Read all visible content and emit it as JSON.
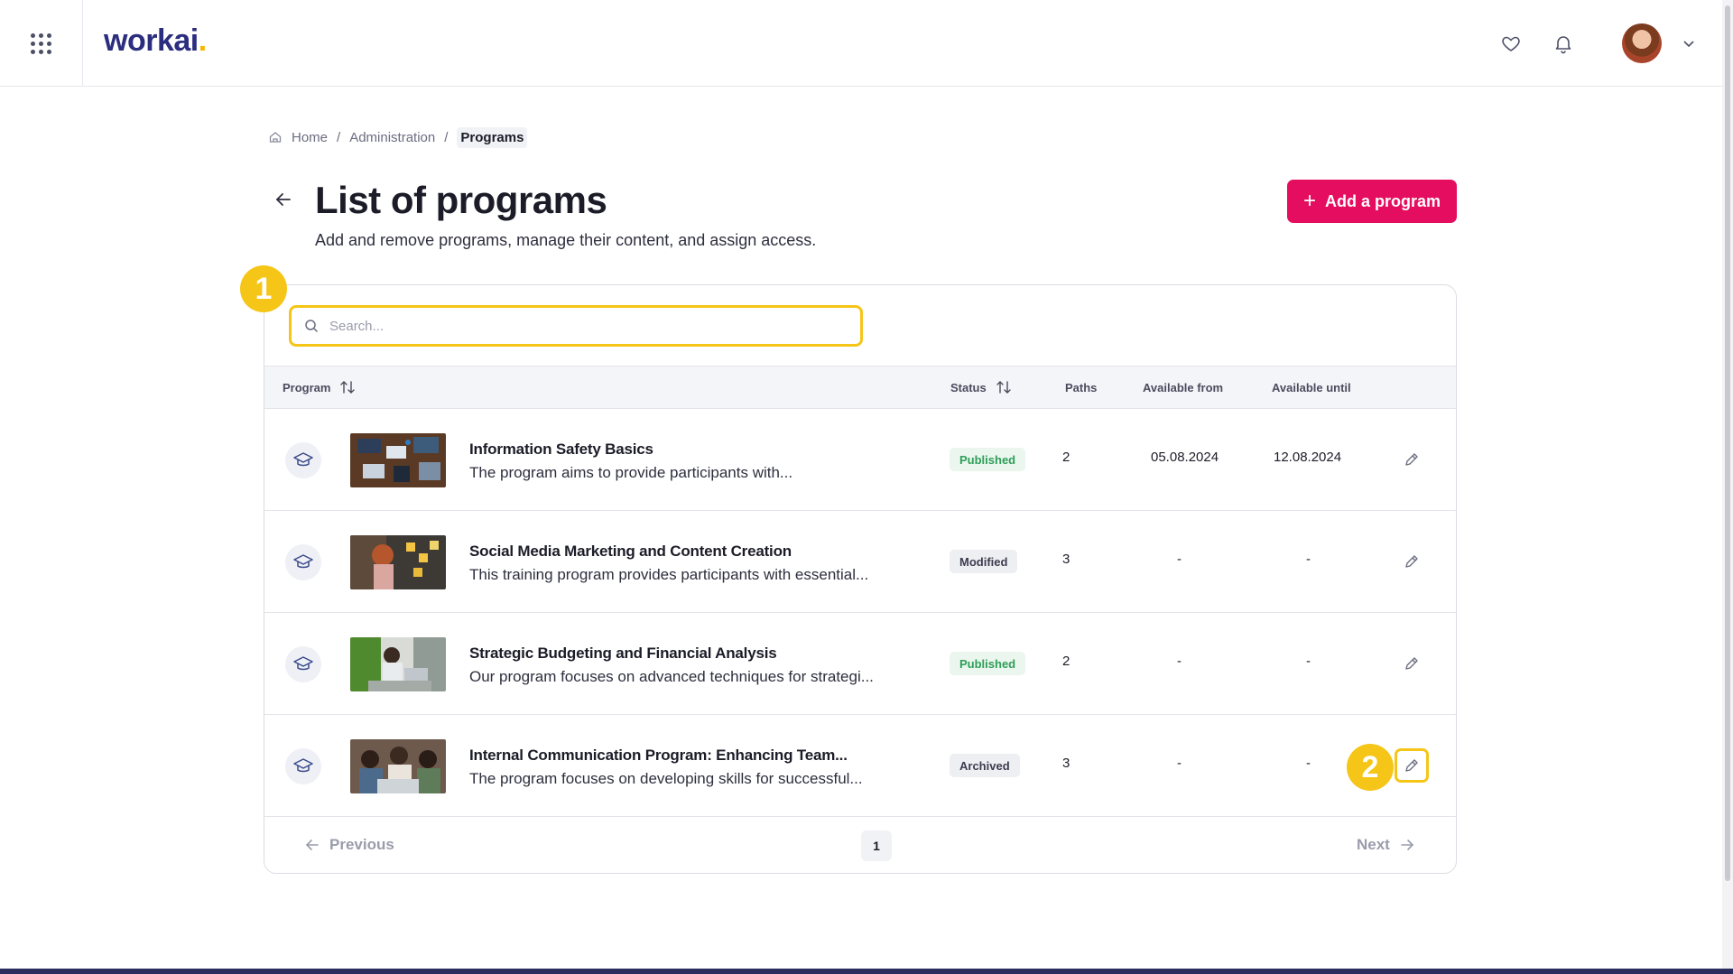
{
  "app": {
    "logo_text": "workai",
    "logo_dot": "."
  },
  "header": {
    "icons": [
      "apps-grid-icon",
      "heart-icon",
      "bell-icon",
      "user-avatar",
      "chevron-down-icon"
    ]
  },
  "breadcrumb": {
    "home": "Home",
    "sep1": "/",
    "admin": "Administration",
    "sep2": "/",
    "current": "Programs"
  },
  "page": {
    "title": "List of programs",
    "subtitle": "Add and remove programs, manage their content, and assign access.",
    "add_button": "Add a program"
  },
  "search": {
    "placeholder": "Search..."
  },
  "table": {
    "headers": {
      "program": "Program",
      "status": "Status",
      "paths": "Paths",
      "available_from": "Available from",
      "available_until": "Available until"
    },
    "rows": [
      {
        "title": "Information Safety Basics",
        "description": "The program aims to provide participants with...",
        "status": "Published",
        "paths": "2",
        "available_from": "05.08.2024",
        "available_until": "12.08.2024"
      },
      {
        "title": "Social Media Marketing and Content Creation",
        "description": "This training program provides participants with essential...",
        "status": "Modified",
        "paths": "3",
        "available_from": "-",
        "available_until": "-"
      },
      {
        "title": "Strategic Budgeting and Financial Analysis",
        "description": "Our program focuses on advanced techniques for strategi...",
        "status": "Published",
        "paths": "2",
        "available_from": "-",
        "available_until": "-"
      },
      {
        "title": "Internal Communication Program: Enhancing Team...",
        "description": "The program focuses on developing skills for successful...",
        "status": "Archived",
        "paths": "3",
        "available_from": "-",
        "available_until": "-"
      }
    ]
  },
  "pagination": {
    "previous": "Previous",
    "page": "1",
    "next": "Next"
  },
  "annotations": {
    "step1": "1",
    "step2": "2"
  },
  "colors": {
    "brand": "#2b2d7e",
    "accent": "#e40d5f",
    "highlight": "#f5c518",
    "published": "#2f9e58"
  }
}
